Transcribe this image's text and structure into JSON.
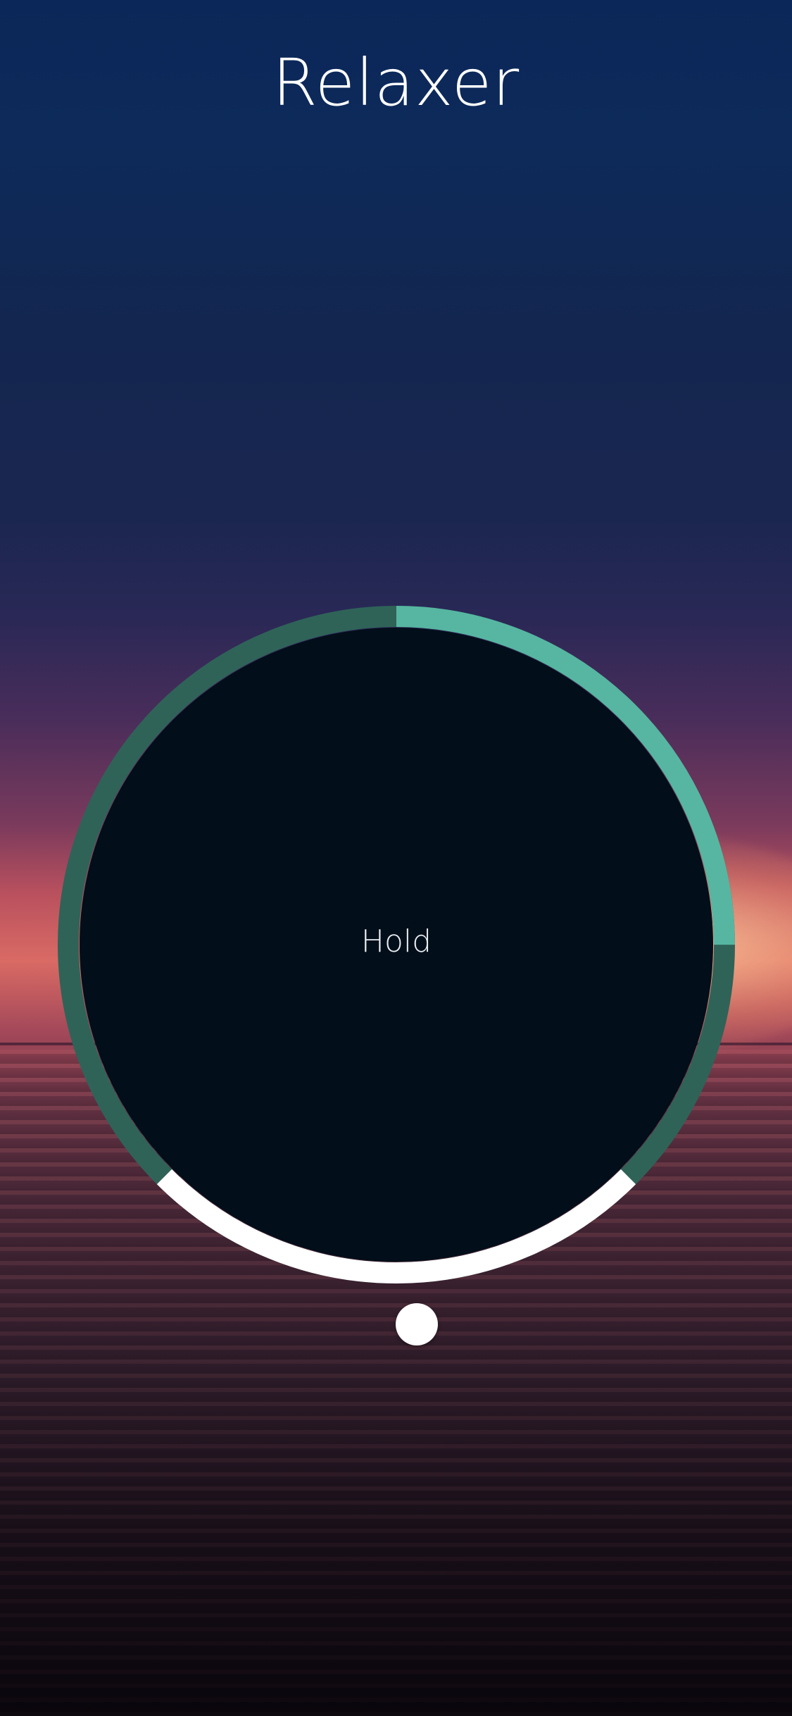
{
  "app": {
    "title": "Relaxer"
  },
  "breathing": {
    "phase_label": "Hold",
    "progress_fraction": 0.25,
    "bottom_segment_fraction": 0.25
  },
  "colors": {
    "progress_active": "#56b6a1",
    "progress_track": "#2f6358",
    "bottom_segment": "#ffffff",
    "circle_fill": "#020e1a",
    "text": "#ffffff"
  }
}
